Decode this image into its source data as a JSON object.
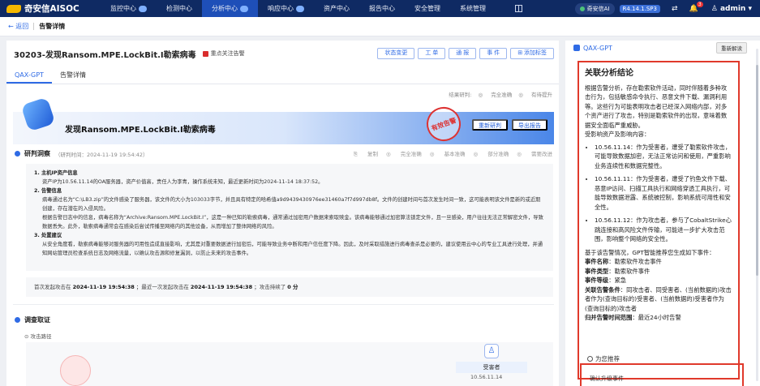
{
  "app": {
    "logo_text": "奇安信AISOC"
  },
  "nav": {
    "items": [
      {
        "label": "监控中心",
        "badge": true
      },
      {
        "label": "检测中心",
        "badge": false
      },
      {
        "label": "分析中心",
        "badge": true
      },
      {
        "label": "响应中心",
        "badge": true
      },
      {
        "label": "资产中心",
        "badge": false
      },
      {
        "label": "报告中心",
        "badge": false
      },
      {
        "label": "安全管理",
        "badge": false
      },
      {
        "label": "系统管理",
        "badge": false
      }
    ],
    "active_index": 2,
    "ai_label": "奇安信AI",
    "version": "R4.14.1.SP3",
    "bell_count": "3",
    "user": "admin"
  },
  "breadcrumb": {
    "back": "返回",
    "title": "告警详情"
  },
  "alert": {
    "title": "30203-发现Ransom.MPE.LockBit.I勒索病毒",
    "focus_label": "重点关注告警",
    "actions": [
      "状态变更",
      "工 单",
      "通 报",
      "事 件",
      "添加标签"
    ]
  },
  "tabs": [
    "QAX-GPT",
    "告警详情"
  ],
  "rating": {
    "label": "结果研判:",
    "options": [
      "完全准确",
      "有待提升"
    ]
  },
  "hero": {
    "title": "发现Ransom.MPE.LockBit.I勒索病毒",
    "stamp": "有效告警",
    "btn_reanalyze": "重新研判",
    "btn_export": "导出报告"
  },
  "insight": {
    "title": "研判洞察",
    "time_meta": "（研判时间：2024-11-19 19:54:42）",
    "copy": "复制",
    "opinions": [
      "完全准确",
      "基本准确",
      "部分准确",
      "需要改进"
    ],
    "sections": [
      {
        "heading": "1. 主机IP资产信息",
        "lines": [
          "资产IP为10.56.11.14的OA服务器，资产价值高，责任人为李青，操作系统未知，最近更新时间为2024-11-14 18:37:52。"
        ]
      },
      {
        "heading": "2. 告警信息",
        "lines": [
          "病毒通过名为“C:\\LB3.zip”的文件感染了服务器，该文件的大小为103033字节，并且具有特定的哈希值a9d9439430976ee31460a7f7d997db8f。文件的创建时间与首次发生时间一致，这可能表明该文件是新的或近期创建，存在潜在的入侵风险。",
          "根据告警日志中的信息，病毒名称为“Archive:Ransom.MPE.LockBit.I”，这是一种已知的勒索病毒，通常通过加密用户数据来索取赎金。该病毒能够通过加密算法锁定文件，且一旦感染，用户往往无法正常解密文件，导致数据丢失。此外，勒索病毒通常会在感染后尝试传播至网络内的其他设备，从而增加了整体网络的风险。"
        ]
      },
      {
        "heading": "3. 处置建议",
        "lines": [
          "从安全角度看，勒索病毒能够对服务器的可用性造成直接影响，尤其是对重要数据进行加密后，可能导致业务中断和用户信任度下降。因此，及时采取措施进行病毒查杀是必要的，建议使用云中心的专业工具进行处理，并通知网站管理员检查系统日志及网络流量，以确认攻击源和修复漏洞，以防止未来的攻击事件。"
        ]
      }
    ],
    "summary": {
      "first_label": "首次发起攻击在",
      "first_time": "2024-11-19 19:54:38",
      "last_label": "；最近一次发起攻击在",
      "last_time": "2024-11-19 19:54:38",
      "duration_label": "；攻击持续了",
      "duration": "0 分"
    }
  },
  "investigation": {
    "title": "调查取证",
    "sub": "攻击路径",
    "victim_label": "受害者",
    "victim_ip": "10.56.11.14"
  },
  "side": {
    "logo": "QAX-GPT",
    "reinterpret": "重新解读",
    "result_title": "关联分析结论",
    "intro": "根据告警分析，存在勒索软件活动，同时伴随着多种攻击行为，包括敏感命令执行、恶意文件下载、漏洞利用等。这些行为可能表明攻击者已经深入网络内部，对多个资产进行了攻击，特别是勒索软件的出现，意味着数据安全面临严重威胁。",
    "impact_heading": "受影响资产及影响内容：",
    "bullets": [
      "10.56.11.14：作为受害者，遭受了勒索软件攻击，可能导致数据加密，无法正常访问和使用，严重影响业务连续性和数据完整性。",
      "10.56.11.11：作为受害者，遭受了钓鱼文件下载、恶意IP访问、扫描工具执行和网络穿透工具执行，可能导致数据泄露、系统被控制，影响系统可用性和安全性。",
      "10.56.11.12：作为攻击者，参与了CobaltStrike心跳连接和高风险文件传输，可能进一步扩大攻击范围，影响整个网络的安全性。"
    ],
    "gpt_text": "基于该告警情况，GPT智能推荐您生成如下事件：",
    "kv": [
      {
        "k": "事件名称",
        "v": "勒索软件攻击事件"
      },
      {
        "k": "事件类型",
        "v": "勒索软件事件"
      },
      {
        "k": "事件等级",
        "v": "紧急"
      },
      {
        "k": "关联告警条件",
        "v": "同攻击者、同受害者、(当前数据的)攻击者作为(查询目标的)受害者、(当前数据的)受害者作为(查询目标的)攻击者"
      },
      {
        "k": "归并告警时间范围",
        "v": "最近24小时告警"
      }
    ],
    "recommend": "为您推荐",
    "confirm": "确认升级事件"
  }
}
